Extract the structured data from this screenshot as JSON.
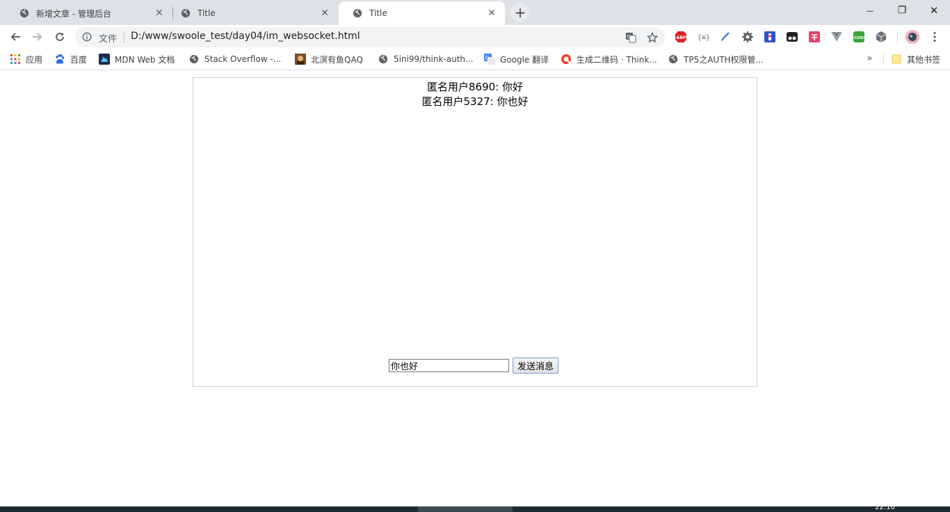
{
  "browser": {
    "tabs": [
      {
        "title": "新增文章 - 管理后台",
        "active": false
      },
      {
        "title": "Title",
        "active": false
      },
      {
        "title": "Title",
        "active": true
      }
    ],
    "close_glyph": "✕",
    "new_tab_glyph": "+",
    "window_controls": {
      "minimize": "—",
      "restore": "❐",
      "close": "✕"
    },
    "address": {
      "chip_label": "文件",
      "url": "D:/www/swoole_test/day04/im_websocket.html"
    },
    "bookmarks": [
      {
        "label": "应用",
        "icon": "apps-grid-icon"
      },
      {
        "label": "百度",
        "icon": "baidu-paw-icon"
      },
      {
        "label": "MDN Web 文档",
        "icon": "mdn-icon"
      },
      {
        "label": "Stack Overflow -...",
        "icon": "globe-icon"
      },
      {
        "label": "北溟有鱼QAQ",
        "icon": "avatar-icon"
      },
      {
        "label": "5ini99/think-auth...",
        "icon": "globe-icon"
      },
      {
        "label": "Google 翻译",
        "icon": "google-translate-icon"
      },
      {
        "label": "生成二维码 · Think...",
        "icon": "qr-tool-icon"
      },
      {
        "label": "TP5之AUTH权限管...",
        "icon": "globe-icon"
      }
    ],
    "bookmarks_more": "»",
    "other_bookmarks": "其他书签"
  },
  "chat": {
    "messages": [
      "匿名用户8690: 你好",
      "匿名用户5327: 你也好"
    ],
    "input_value": "你也好",
    "send_label": "发送消息"
  },
  "taskbar": {
    "clock_partial": "22:10"
  }
}
